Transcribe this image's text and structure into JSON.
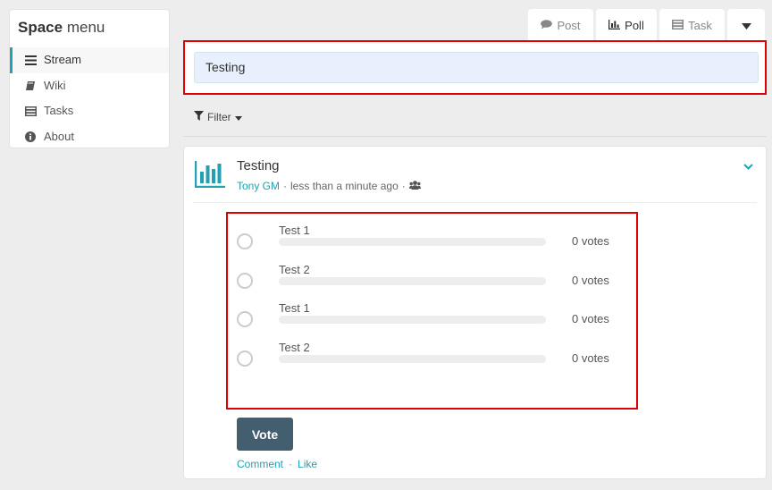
{
  "sidebar": {
    "title_bold": "Space",
    "title_light": "menu",
    "items": [
      {
        "label": "Stream",
        "icon": "bars-icon"
      },
      {
        "label": "Wiki",
        "icon": "book-icon"
      },
      {
        "label": "Tasks",
        "icon": "tasks-icon"
      },
      {
        "label": "About",
        "icon": "info-circle-icon"
      }
    ]
  },
  "tabs": {
    "post": "Post",
    "poll": "Poll",
    "task": "Task"
  },
  "composer": {
    "value": "Testing"
  },
  "filter": {
    "label": "Filter"
  },
  "post": {
    "title": "Testing",
    "author": "Tony GM",
    "separator": "·",
    "time": "less than a minute ago",
    "visibility_icon": "users-icon",
    "options": [
      {
        "label": "Test 1",
        "votes": "0 votes",
        "fraction": 0
      },
      {
        "label": "Test 2",
        "votes": "0 votes",
        "fraction": 0
      },
      {
        "label": "Test 1",
        "votes": "0 votes",
        "fraction": 0
      },
      {
        "label": "Test 2",
        "votes": "0 votes",
        "fraction": 0
      }
    ],
    "vote_label": "Vote",
    "comment_label": "Comment",
    "like_label": "Like"
  },
  "colors": {
    "accent": "#21a1b3",
    "vote_button": "#435f6f",
    "highlight_border": "#e00000"
  }
}
